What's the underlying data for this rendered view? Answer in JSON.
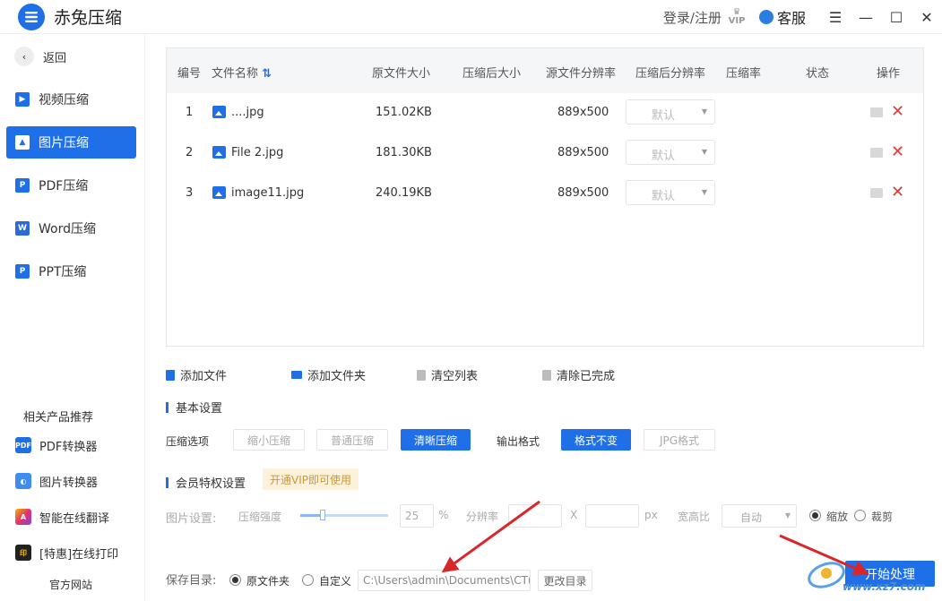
{
  "app": {
    "title": "赤兔压缩"
  },
  "header": {
    "login": "登录/注册",
    "vip": "VIP",
    "service": "客服"
  },
  "sidebar": {
    "back": "返回",
    "items": [
      {
        "label": "视频压缩",
        "icon": "video-icon",
        "active": false
      },
      {
        "label": "图片压缩",
        "icon": "image-icon",
        "active": true
      },
      {
        "label": "PDF压缩",
        "icon": "pdf-icon",
        "active": false
      },
      {
        "label": "Word压缩",
        "icon": "word-icon",
        "active": false
      },
      {
        "label": "PPT压缩",
        "icon": "ppt-icon",
        "active": false
      }
    ],
    "rec_title": "相关产品推荐",
    "rec_items": [
      {
        "label": "PDF转换器",
        "icon": "pdf-converter-icon"
      },
      {
        "label": "图片转换器",
        "icon": "image-converter-icon"
      },
      {
        "label": "智能在线翻译",
        "icon": "translate-icon"
      },
      {
        "label": "[特惠]在线打印",
        "icon": "print-icon"
      }
    ],
    "official": "官方网站"
  },
  "table": {
    "headers": [
      "编号",
      "文件名称",
      "原文件大小",
      "压缩后大小",
      "源文件分辨率",
      "压缩后分辨率",
      "压缩率",
      "状态",
      "操作"
    ],
    "rows": [
      {
        "no": "1",
        "name": "....jpg",
        "size": "151.02KB",
        "resolution": "889x500",
        "target": "默认"
      },
      {
        "no": "2",
        "name": "File 2.jpg",
        "size": "181.30KB",
        "resolution": "889x500",
        "target": "默认"
      },
      {
        "no": "3",
        "name": "image11.jpg",
        "size": "240.19KB",
        "resolution": "889x500",
        "target": "默认"
      }
    ]
  },
  "actions": {
    "add_file": "添加文件",
    "add_folder": "添加文件夹",
    "clear_list": "清空列表",
    "clear_done": "清除已完成"
  },
  "basic": {
    "title": "基本设置",
    "compress_label": "压缩选项",
    "compress_options": [
      "缩小压缩",
      "普通压缩",
      "清晰压缩"
    ],
    "compress_selected": "清晰压缩",
    "format_label": "输出格式",
    "format_options": [
      "格式不变",
      "JPG格式"
    ],
    "format_selected": "格式不变"
  },
  "vip": {
    "title": "会员特权设置",
    "tag": "开通VIP即可使用",
    "image_settings": "图片设置:",
    "strength_label": "压缩强度",
    "strength_value": "25",
    "strength_unit": "%",
    "resolution_label": "分辨率",
    "x": "X",
    "px": "px",
    "ratio_label": "宽高比",
    "ratio_value": "自动",
    "scale": "缩放",
    "crop": "裁剪"
  },
  "save": {
    "label": "保存目录:",
    "original": "原文件夹",
    "custom": "自定义",
    "path": "C:\\Users\\admin\\Documents\\CT(",
    "change": "更改目录"
  },
  "start_button": "开始处理",
  "watermark": "www.xz7.com",
  "colors": {
    "accent": "#1e6fe8",
    "danger": "#e53935",
    "vip_bg": "#fdf1dc",
    "arrow": "#d9262b"
  }
}
